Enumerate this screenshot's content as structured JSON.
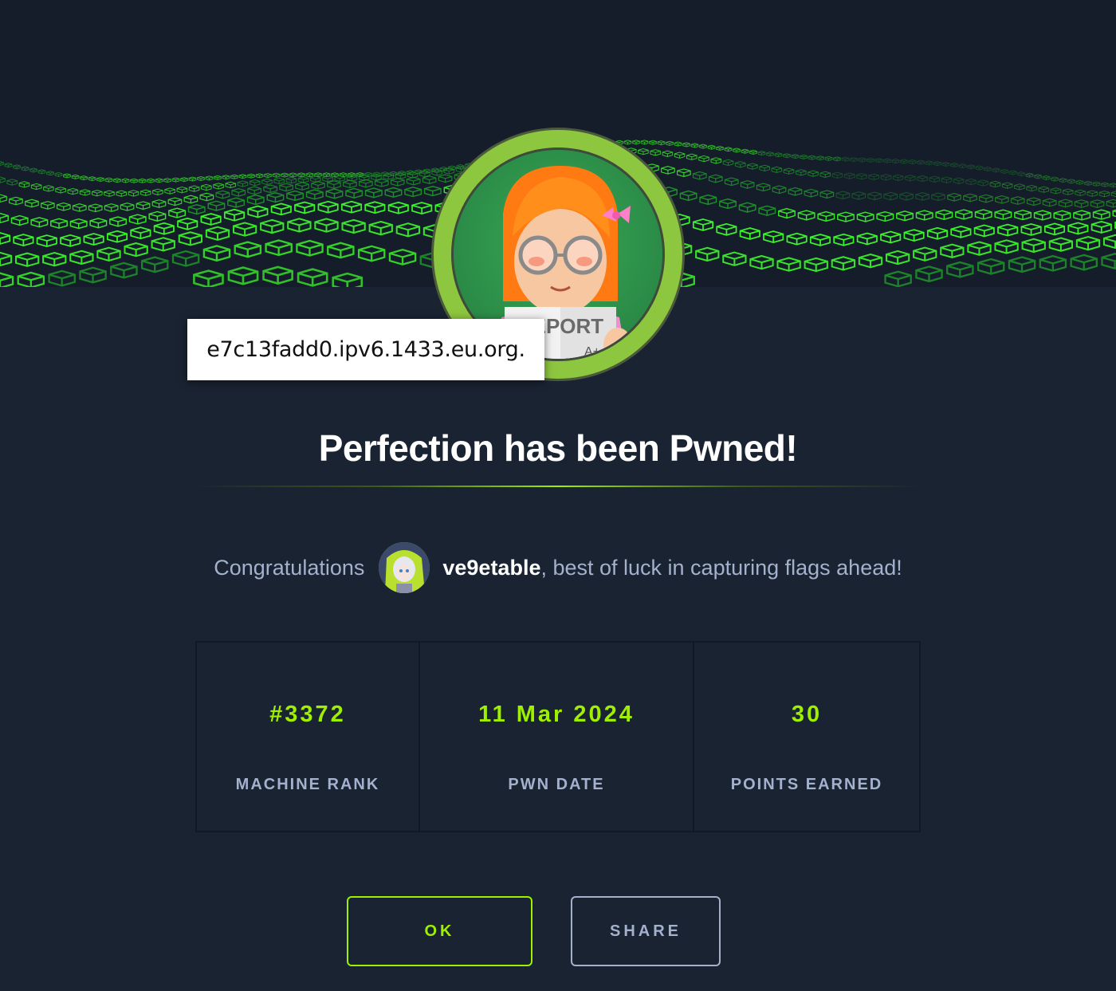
{
  "tooltip": {
    "text": "e7c13fadd0.ipv6.1433.eu.org."
  },
  "machine": {
    "name": "Perfection",
    "avatar_icon": "machine-avatar-report-girl",
    "avatar_paper_text": "REPORT",
    "avatar_grade_1": "A+",
    "avatar_grade_2": "A+"
  },
  "title": "Perfection has been Pwned!",
  "congrats": {
    "prefix": "Congratulations",
    "username": "ve9etable",
    "suffix": ", best of luck in capturing flags ahead!"
  },
  "stats": [
    {
      "value": "#3372",
      "label": "MACHINE RANK"
    },
    {
      "value": "11 Mar 2024",
      "label": "PWN DATE"
    },
    {
      "value": "30",
      "label": "POINTS EARNED"
    }
  ],
  "buttons": {
    "ok": "OK",
    "share": "SHARE"
  },
  "colors": {
    "accent": "#9fef00",
    "background": "#1a2332",
    "muted_text": "#a4b1cd"
  }
}
